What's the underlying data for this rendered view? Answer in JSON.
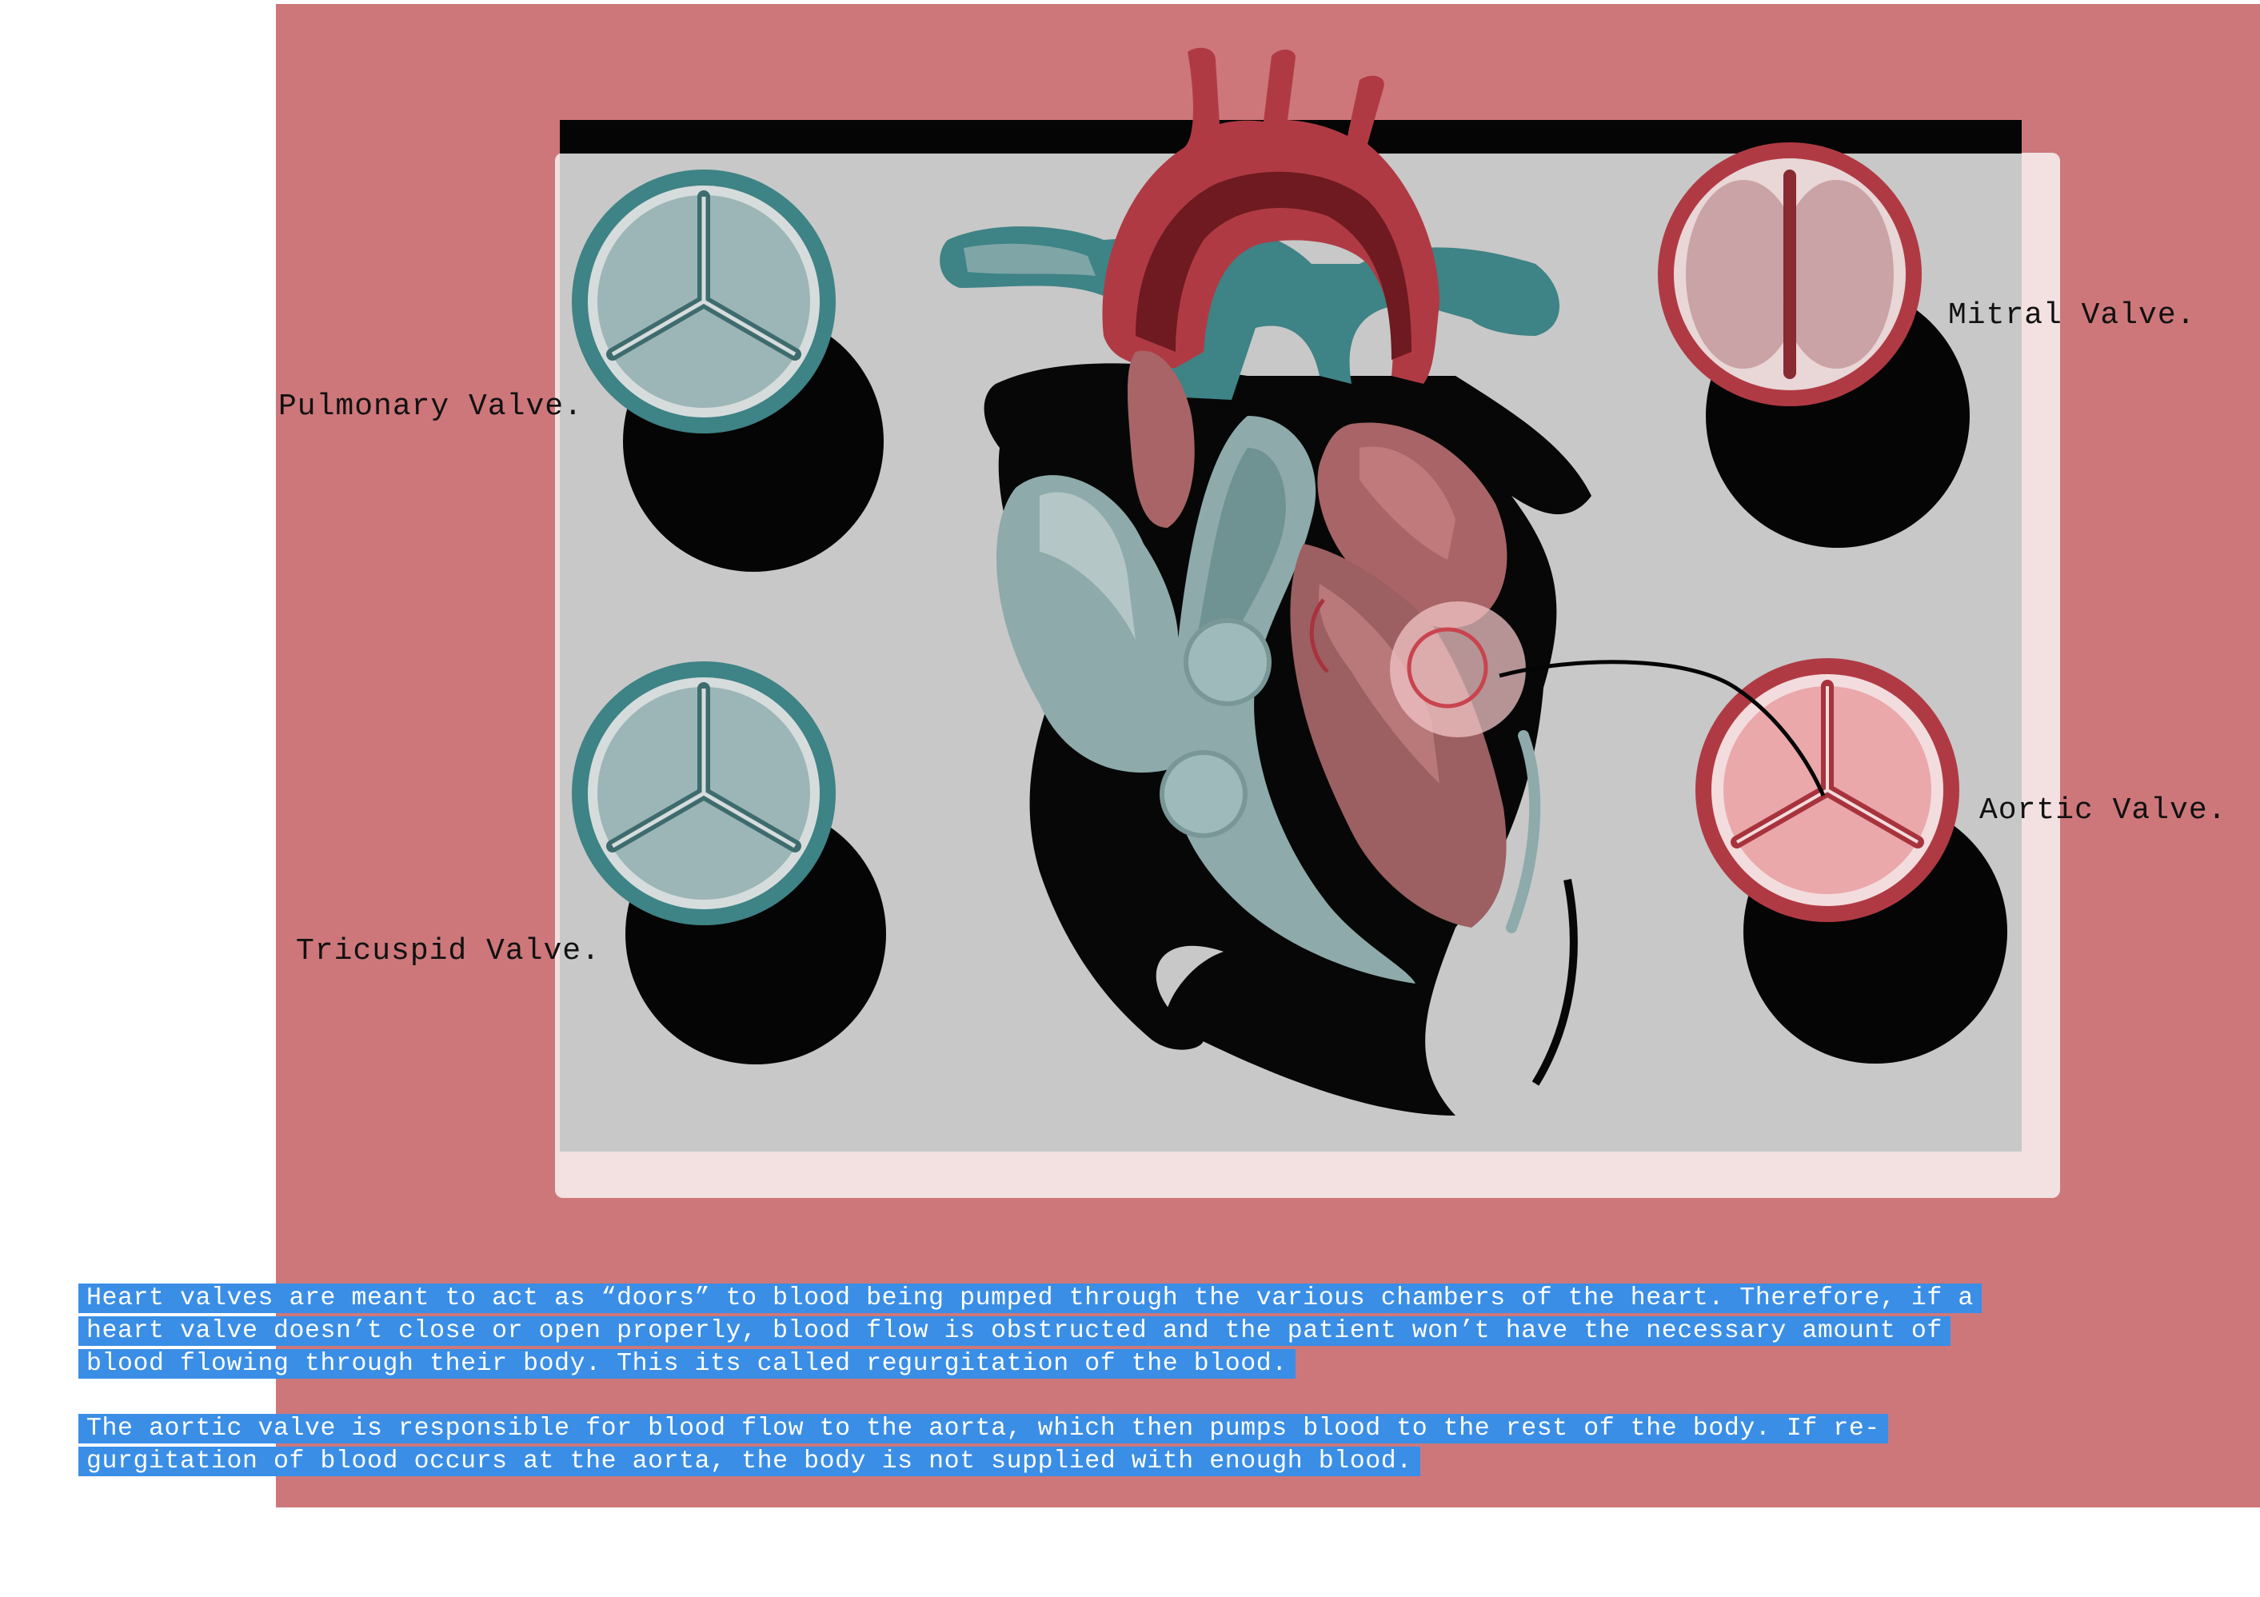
{
  "labels": {
    "pulmonary": "Pulmonary Valve.",
    "tricuspid": "Tricuspid Valve.",
    "mitral": "Mitral Valve.",
    "aortic": "Aortic Valve."
  },
  "paragraphs": [
    "Heart valves are meant to act as “doors” to blood being pumped through the various chambers of the heart. Therefore, if a heart valve doesn’t close or open properly, blood flow is obstructed and the patient won’t have the necessary amount of blood flowing through their body. This its called regurgitation of the blood.",
    "The aortic valve is responsible for blood flow to the aorta, which then pumps blood to the rest of the body. If re- gurgitation of blood occurs at the aorta, the body is not supplied with enough blood."
  ],
  "colors": {
    "background_panel": "#cd777a",
    "board": "#c8c8c8",
    "board_frame": "#f3e1e1",
    "teal": "#3e8385",
    "teal_light": "#9cb6b7",
    "red": "#b03a44",
    "red_dark": "#6e1a20",
    "pink": "#eaa8ab",
    "highlight": "#3a8ee6"
  },
  "icons": {
    "pulmonary_valve": "tricuspid-valve-icon",
    "tricuspid_valve": "tricuspid-valve-icon",
    "mitral_valve": "bicuspid-valve-icon",
    "aortic_valve": "tricuspid-valve-icon",
    "heart": "heart-anatomy-icon"
  }
}
